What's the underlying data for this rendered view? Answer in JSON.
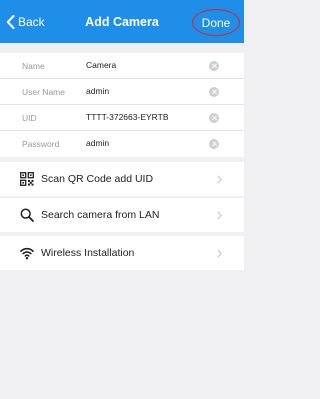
{
  "nav": {
    "back_label": "Back",
    "title": "Add Camera",
    "done_label": "Done"
  },
  "fields": [
    {
      "label": "Name",
      "value": "Camera"
    },
    {
      "label": "User Name",
      "value": "admin"
    },
    {
      "label": "UID",
      "value": "TTTT-372663-EYRTB"
    },
    {
      "label": "Password",
      "value": "admin"
    }
  ],
  "options": [
    {
      "label": "Scan QR Code add UID",
      "icon": "qr-code-icon"
    },
    {
      "label": "Search camera from LAN",
      "icon": "search-icon"
    },
    {
      "label": "Wireless Installation",
      "icon": "wifi-icon"
    }
  ],
  "colors": {
    "nav_bar": "#1e8ee8",
    "highlight_circle": "#d8262a",
    "background": "#f0f0f2"
  }
}
